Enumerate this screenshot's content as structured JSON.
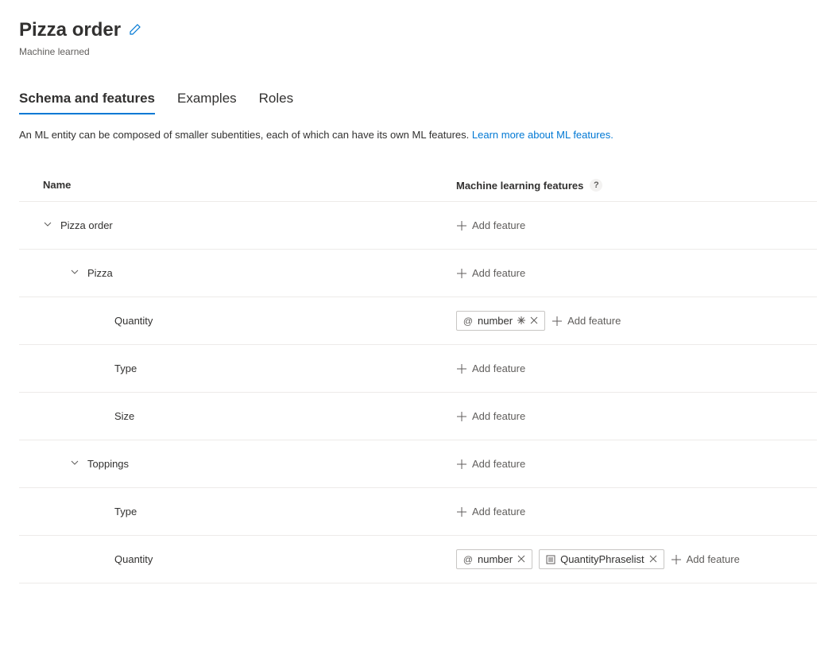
{
  "header": {
    "title": "Pizza order",
    "subtitle": "Machine learned"
  },
  "tabs": [
    {
      "label": "Schema and features",
      "active": true
    },
    {
      "label": "Examples",
      "active": false
    },
    {
      "label": "Roles",
      "active": false
    }
  ],
  "description": {
    "text": "An ML entity can be composed of smaller subentities, each of which can have its own ML features. ",
    "link": "Learn more about ML features."
  },
  "columns": {
    "name": "Name",
    "features": "Machine learning features"
  },
  "addFeatureLabel": "Add feature",
  "rows": [
    {
      "name": "Pizza order",
      "indent": 0,
      "expandable": true,
      "features": []
    },
    {
      "name": "Pizza",
      "indent": 1,
      "expandable": true,
      "features": []
    },
    {
      "name": "Quantity",
      "indent": 2,
      "expandable": false,
      "features": [
        {
          "label": "number",
          "iconType": "at",
          "hasAsterisk": true,
          "hasClose": true
        }
      ]
    },
    {
      "name": "Type",
      "indent": 2,
      "expandable": false,
      "features": []
    },
    {
      "name": "Size",
      "indent": 2,
      "expandable": false,
      "features": []
    },
    {
      "name": "Toppings",
      "indent": 1,
      "expandable": true,
      "features": []
    },
    {
      "name": "Type",
      "indent": 2,
      "expandable": false,
      "features": []
    },
    {
      "name": "Quantity",
      "indent": 2,
      "expandable": false,
      "features": [
        {
          "label": "number",
          "iconType": "at",
          "hasAsterisk": false,
          "hasClose": true
        },
        {
          "label": "QuantityPhraselist",
          "iconType": "list",
          "hasAsterisk": false,
          "hasClose": true
        }
      ]
    }
  ]
}
